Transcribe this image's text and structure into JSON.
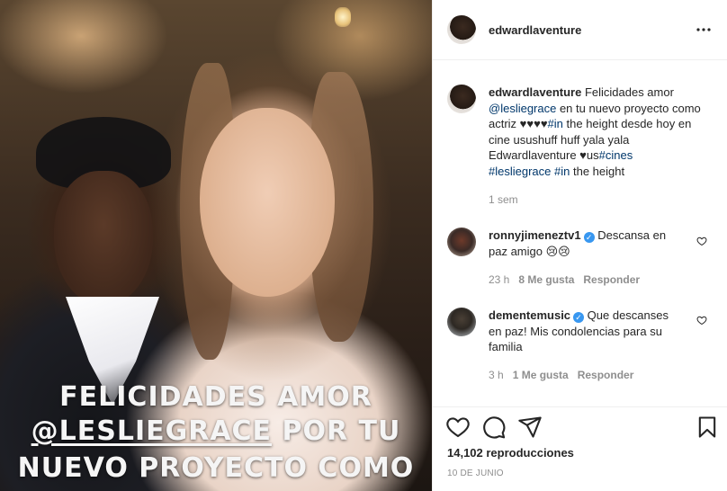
{
  "media": {
    "caption_line1": "FELICIDADES AMOR",
    "caption_mention": "@LESLIEGRACE",
    "caption_line2_rest": " POR TU",
    "caption_line3": "NUEVO PROYECTO COMO"
  },
  "header": {
    "username": "edwardlaventure"
  },
  "post_caption": {
    "username": "edwardlaventure",
    "text_1": " Felicidades amor ",
    "mention": "@lesliegrace",
    "text_2": " en tu nuevo proyecto como actriz ♥♥♥♥",
    "tag_in_1": "#in",
    "text_3": " the height desde hoy en cine usushuff huff yala yala Edwardlaventure ♥us",
    "tag_cines": "#cines",
    "tag_lesliegrace": "#lesliegrace",
    "tag_in_2": "#in",
    "text_4": " the height",
    "time": "1 sem"
  },
  "comments": [
    {
      "username": "ronnyjimeneztv1",
      "text": " Descansa en paz amigo 😢😢",
      "time": "23 h",
      "likes": "8 Me gusta",
      "reply": "Responder"
    },
    {
      "username": "dementemusic",
      "text": " Que descanses en paz! Mis condolencias para su familia",
      "time": "3 h",
      "likes": "1 Me gusta",
      "reply": "Responder"
    }
  ],
  "footer": {
    "views": "14,102 reproducciones",
    "date": "10 DE JUNIO"
  },
  "icons": {
    "like": "heart-icon",
    "comment": "comment-icon",
    "share": "share-icon",
    "save": "bookmark-icon",
    "more": "more-icon",
    "verified": "verified-badge-icon"
  },
  "colors": {
    "link": "#00376b",
    "verified": "#3897f0",
    "muted": "#8e8e8e"
  }
}
